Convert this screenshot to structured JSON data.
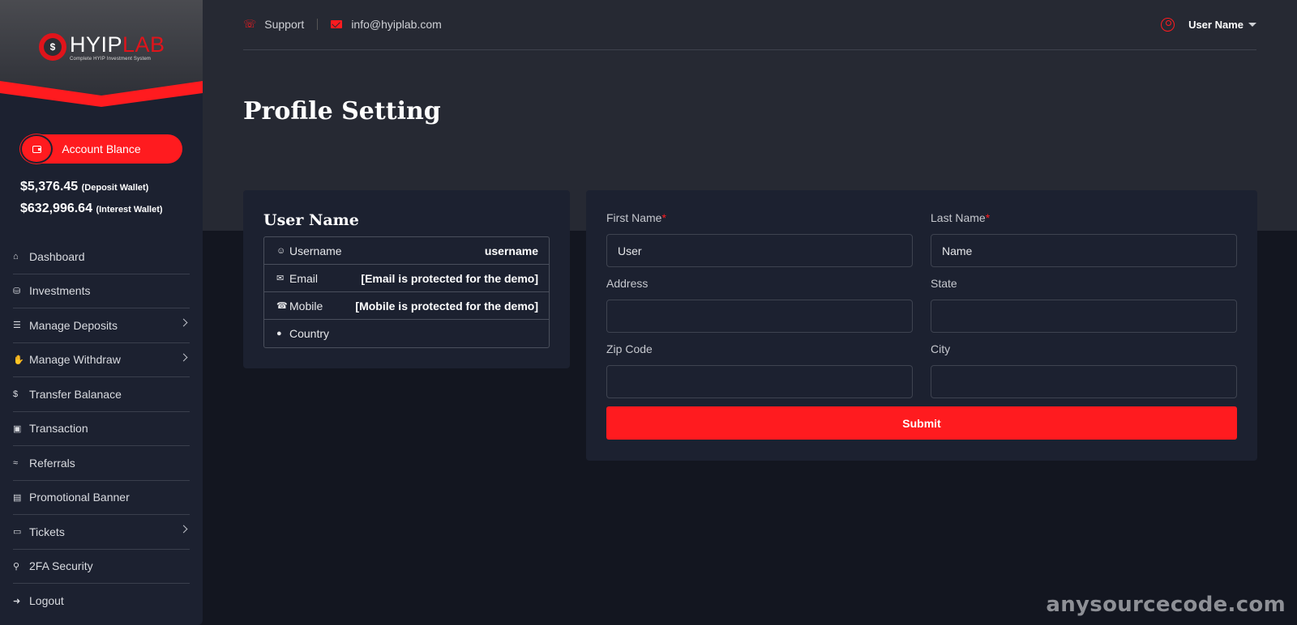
{
  "brand": {
    "logo_text_a": "HYIP",
    "logo_text_b": "LAB",
    "tagline": "Complete HYIP Investment System",
    "accent": "#ff1b1f"
  },
  "sidebar": {
    "balance_button": "Account Blance",
    "wallets": [
      {
        "amount": "$5,376.45",
        "label": "(Deposit Wallet)"
      },
      {
        "amount": "$632,996.64",
        "label": "(Interest Wallet)"
      }
    ],
    "items": [
      {
        "label": "Dashboard",
        "icon": "home-icon",
        "has_submenu": false
      },
      {
        "label": "Investments",
        "icon": "coins-icon",
        "has_submenu": false
      },
      {
        "label": "Manage Deposits",
        "icon": "layers-icon",
        "has_submenu": true
      },
      {
        "label": "Manage Withdraw",
        "icon": "hand-coin-icon",
        "has_submenu": true
      },
      {
        "label": "Transfer Balanace",
        "icon": "dollar-icon",
        "has_submenu": false
      },
      {
        "label": "Transaction",
        "icon": "money-stack-icon",
        "has_submenu": false
      },
      {
        "label": "Referrals",
        "icon": "handshake-icon",
        "has_submenu": false
      },
      {
        "label": "Promotional Banner",
        "icon": "banner-icon",
        "has_submenu": false
      },
      {
        "label": "Tickets",
        "icon": "ticket-icon",
        "has_submenu": true
      },
      {
        "label": "2FA Security",
        "icon": "user-lock-icon",
        "has_submenu": false
      },
      {
        "label": "Logout",
        "icon": "logout-icon",
        "has_submenu": false
      }
    ]
  },
  "header": {
    "support_label": "Support",
    "email": "info@hyiplab.com",
    "user_name": "User Name"
  },
  "page": {
    "title": "Profile Setting"
  },
  "profile": {
    "name": "User Name",
    "rows": [
      {
        "label": "Username",
        "icon": "user-icon",
        "value": "username"
      },
      {
        "label": "Email",
        "icon": "envelope-icon",
        "value": "[Email is protected for the demo]"
      },
      {
        "label": "Mobile",
        "icon": "phone-icon",
        "value": "[Mobile is protected for the demo]"
      },
      {
        "label": "Country",
        "icon": "globe-icon",
        "value": ""
      }
    ]
  },
  "form": {
    "first_name": {
      "label": "First Name",
      "value": "User",
      "required": true
    },
    "last_name": {
      "label": "Last Name",
      "value": "Name",
      "required": true
    },
    "address": {
      "label": "Address",
      "value": ""
    },
    "state": {
      "label": "State",
      "value": ""
    },
    "zip": {
      "label": "Zip Code",
      "value": ""
    },
    "city": {
      "label": "City",
      "value": ""
    },
    "submit_label": "Submit"
  },
  "watermark": "anysourcecode.com"
}
